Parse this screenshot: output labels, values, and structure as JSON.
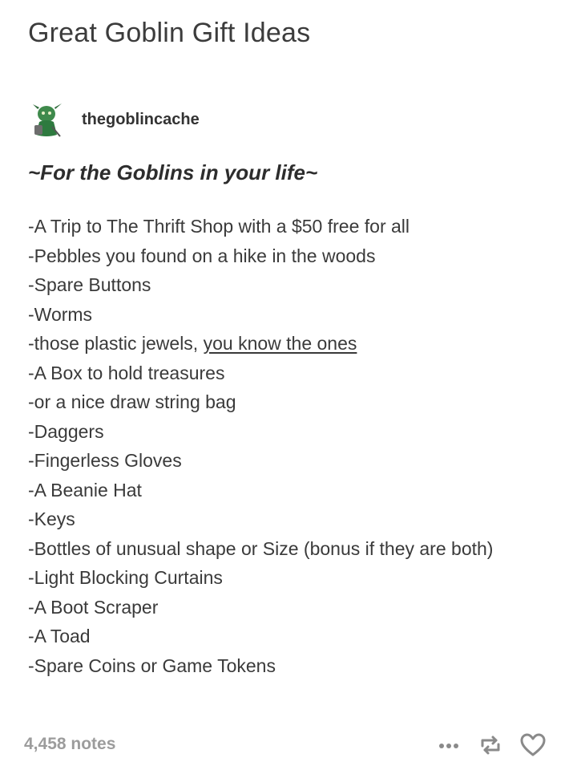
{
  "post": {
    "title": "Great Goblin Gift Ideas",
    "author": "thegoblincache",
    "heading": "~For the Goblins in your life~",
    "items": [
      "-A Trip to The Thrift Shop with a $50 free for all",
      "-Pebbles you found on a hike in the woods",
      "-Spare Buttons",
      "-Worms"
    ],
    "jewels_prefix": "-those plastic jewels, ",
    "jewels_link": "you know the ones",
    "items2": [
      "-A Box to hold treasures",
      "-or a nice draw string bag",
      "-Daggers",
      "-Fingerless Gloves",
      "-A Beanie Hat",
      "-Keys",
      "-Bottles of unusual shape or Size (bonus if they are both)",
      "-Light Blocking Curtains",
      "-A Boot Scraper",
      "-A Toad",
      "-Spare Coins or Game Tokens"
    ]
  },
  "footer": {
    "notes": "4,458 notes",
    "icons": [
      "more-icon",
      "reblog-icon",
      "heart-icon"
    ]
  }
}
